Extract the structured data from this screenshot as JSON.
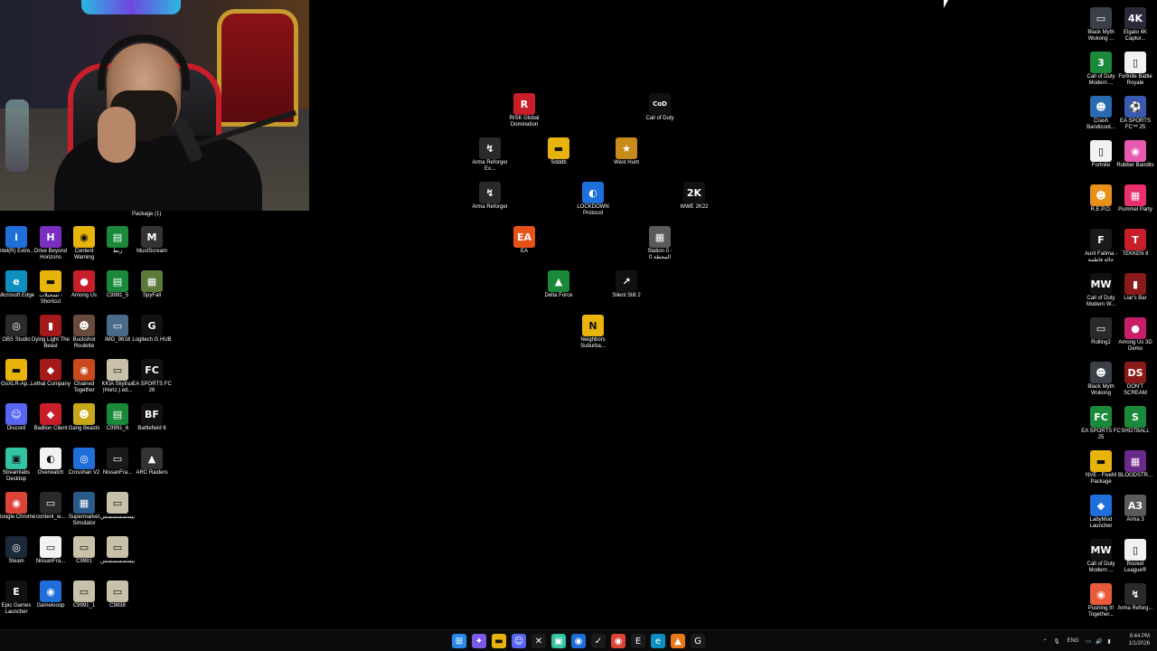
{
  "webcam": {
    "package_label": "Package (1)"
  },
  "icon_colors": {
    "default": "#3a3f48",
    "blue": "#1e6fd9",
    "green": "#1a8a3a",
    "red": "#c81e2a",
    "yellow": "#e8b40c",
    "purple": "#7b2fc2",
    "white": "#f2f2f2",
    "dark": "#1a1a1a"
  },
  "left_icons": [
    {
      "label": "Intel(R) Extre...",
      "icon": "intel-icon",
      "glyph": "i",
      "color": "#1e6fd9"
    },
    {
      "label": "Drive Beyond Horizons",
      "icon": "drive-beyond-horizons-icon",
      "glyph": "H",
      "color": "#7b2fc2"
    },
    {
      "label": "Content Warning",
      "icon": "content-warning-icon",
      "glyph": "◉",
      "color": "#e8b40c"
    },
    {
      "label": "زنط",
      "icon": "steam-shortcut-icon",
      "glyph": "▤",
      "color": "#1a8a3a"
    },
    {
      "label": "MustScream",
      "icon": "mustscream-icon",
      "glyph": "M",
      "color": "#333333"
    },
    {
      "label": "Microsoft Edge",
      "icon": "edge-icon",
      "glyph": "e",
      "color": "#0f8fbf"
    },
    {
      "label": "تسجيلات - Shortcut",
      "icon": "folder-shortcut-icon",
      "glyph": "▬",
      "color": "#e8b40c"
    },
    {
      "label": "Among Us",
      "icon": "among-us-icon",
      "glyph": "●",
      "color": "#c81e2a"
    },
    {
      "label": "C9991_5",
      "icon": "c9991-5-icon",
      "glyph": "▤",
      "color": "#1a8a3a"
    },
    {
      "label": "SpyFall",
      "icon": "spyfall-icon",
      "glyph": "▦",
      "color": "#5a7a3a"
    },
    {
      "label": "OBS Studio",
      "icon": "obs-icon",
      "glyph": "◎",
      "color": "#2a2a2a"
    },
    {
      "label": "Dying Light The Beast",
      "icon": "dying-light-icon",
      "glyph": "▮",
      "color": "#a31a1a"
    },
    {
      "label": "Buckshot Roulette",
      "icon": "buckshot-roulette-icon",
      "glyph": "☻",
      "color": "#6a4a3a"
    },
    {
      "label": "IMG_9618",
      "icon": "image-file-icon",
      "glyph": "▭",
      "color": "#4a6a8a"
    },
    {
      "label": "Logitech G HUB",
      "icon": "logitech-icon",
      "glyph": "G",
      "color": "#111111"
    },
    {
      "label": "GoXLR-Ap...",
      "icon": "goxlr-folder-icon",
      "glyph": "▬",
      "color": "#e8b40c"
    },
    {
      "label": "Lethal Company",
      "icon": "lethal-company-icon",
      "glyph": "◆",
      "color": "#a31a1a"
    },
    {
      "label": "Chained Together",
      "icon": "chained-together-icon",
      "glyph": "◉",
      "color": "#c84a1a"
    },
    {
      "label": "KKIA Skytrax (Horiz.) ed...",
      "icon": "kkia-image-icon",
      "glyph": "▭",
      "color": "#c8c0a8"
    },
    {
      "label": "EA SPORTS FC 26",
      "icon": "ea-fc26-icon",
      "glyph": "FC",
      "color": "#111111"
    },
    {
      "label": "Discord",
      "icon": "discord-icon",
      "glyph": "☺",
      "color": "#5865f2"
    },
    {
      "label": "Badlion Client",
      "icon": "badlion-icon",
      "glyph": "◆",
      "color": "#c81e2a"
    },
    {
      "label": "Gang Beasts",
      "icon": "gang-beasts-icon",
      "glyph": "☻",
      "color": "#c8a81a"
    },
    {
      "label": "C9991_6",
      "icon": "c9991-6-icon",
      "glyph": "▤",
      "color": "#1a8a3a"
    },
    {
      "label": "Battlefield 6",
      "icon": "battlefield-6-icon",
      "glyph": "BF",
      "color": "#111111"
    },
    {
      "label": "Streamlabs Desktop",
      "icon": "streamlabs-icon",
      "glyph": "▣",
      "color": "#31c3a2"
    },
    {
      "label": "Overwatch",
      "icon": "overwatch-icon",
      "glyph": "◐",
      "color": "#f2f2f2"
    },
    {
      "label": "Crosshair V2",
      "icon": "crosshair-icon",
      "glyph": "◎",
      "color": "#1e6fd9"
    },
    {
      "label": "NissanFra...",
      "icon": "nissan-image-icon",
      "glyph": "▭",
      "color": "#1a1a1a"
    },
    {
      "label": "ARC Raiders",
      "icon": "arc-raiders-icon",
      "glyph": "▲",
      "color": "#333333"
    },
    {
      "label": "Google Chrome",
      "icon": "chrome-icon",
      "glyph": "◉",
      "color": "#db4437"
    },
    {
      "label": "content_w...",
      "icon": "content-file-icon",
      "glyph": "▭",
      "color": "#2a2a2a"
    },
    {
      "label": "Supermarket Simulator",
      "icon": "supermarket-simulator-icon",
      "glyph": "▦",
      "color": "#2a5a8a"
    },
    {
      "label": "ييسسسسسس",
      "icon": "video-file-icon",
      "glyph": "▭",
      "color": "#c8c0a8"
    },
    {
      "label": "",
      "icon": "",
      "glyph": "",
      "color": ""
    },
    {
      "label": "Steam",
      "icon": "steam-icon",
      "glyph": "◎",
      "color": "#1b2838"
    },
    {
      "label": "NissanFra...",
      "icon": "nissan-image-2-icon",
      "glyph": "▭",
      "color": "#f2f2f2"
    },
    {
      "label": "C9991",
      "icon": "c9991-icon",
      "glyph": "▭",
      "color": "#c8c0a8"
    },
    {
      "label": "ييسسسسسس",
      "icon": "video-file-2-icon",
      "glyph": "▭",
      "color": "#c8c0a8"
    },
    {
      "label": "",
      "icon": "",
      "glyph": "",
      "color": ""
    },
    {
      "label": "Epic Games Launcher",
      "icon": "epic-games-icon",
      "glyph": "E",
      "color": "#111111"
    },
    {
      "label": "Gamelooop",
      "icon": "gameloop-icon",
      "glyph": "◉",
      "color": "#1e6fd9"
    },
    {
      "label": "C9991_1",
      "icon": "c9991-1-icon",
      "glyph": "▭",
      "color": "#c8c0a8"
    },
    {
      "label": "C9838",
      "icon": "c9838-icon",
      "glyph": "▭",
      "color": "#c8c0a8"
    }
  ],
  "center_icons": [
    {
      "label": "RISK Global Domination",
      "icon": "risk-icon",
      "glyph": "R",
      "color": "#c81e2a",
      "pos": "a"
    },
    {
      "label": "Call of Duty",
      "icon": "call-of-duty-icon",
      "glyph": "CoD",
      "color": "#111111",
      "pos": "b"
    },
    {
      "label": "Arma Reforger Ex...",
      "icon": "arma-reforger-ex-icon",
      "glyph": "↯",
      "color": "#2a2a2a",
      "pos": "c"
    },
    {
      "label": "Sdddb",
      "icon": "sdddb-folder-icon",
      "glyph": "▬",
      "color": "#e8b40c",
      "pos": "d"
    },
    {
      "label": "West Hunt",
      "icon": "west-hunt-icon",
      "glyph": "★",
      "color": "#c88a1a",
      "pos": "e"
    },
    {
      "label": "Arma Reforger",
      "icon": "arma-reforger-icon",
      "glyph": "↯",
      "color": "#2a2a2a",
      "pos": "f"
    },
    {
      "label": "LOCKDOWN Protocol",
      "icon": "lockdown-protocol-icon",
      "glyph": "◐",
      "color": "#1e6fd9",
      "pos": "g"
    },
    {
      "label": "WWE 2K22",
      "icon": "wwe-2k22-icon",
      "glyph": "2K",
      "color": "#111111",
      "pos": "h"
    },
    {
      "label": "EA",
      "icon": "ea-icon",
      "glyph": "EA",
      "color": "#e8501a",
      "pos": "i"
    },
    {
      "label": "Station 0 - المحطة 0",
      "icon": "station-0-icon",
      "glyph": "▦",
      "color": "#5a5a5a",
      "pos": "j"
    },
    {
      "label": "Delta Force",
      "icon": "delta-force-icon",
      "glyph": "▲",
      "color": "#1a8a3a",
      "pos": "k"
    },
    {
      "label": "Silent Still 2",
      "icon": "silent-still-2-icon",
      "glyph": "↗",
      "color": "#111111",
      "pos": "l"
    },
    {
      "label": "Neighbors Suburba...",
      "icon": "neighbors-suburbia-icon",
      "glyph": "N",
      "color": "#e8b40c",
      "pos": "m"
    }
  ],
  "right_icons": [
    {
      "label": "Black Myth Wukong ...",
      "icon": "black-myth-wukong-icon",
      "glyph": "▭",
      "color": "#3a3f48"
    },
    {
      "label": "Elgato 4K Captur...",
      "icon": "elgato-4k-icon",
      "glyph": "4K",
      "color": "#2a2a3a"
    },
    {
      "label": "Call of Duty Modern ...",
      "icon": "cod-modern-icon",
      "glyph": "3",
      "color": "#1a8a3a"
    },
    {
      "label": "Fortnite Battle Royale",
      "icon": "fortnite-file-icon",
      "glyph": "▯",
      "color": "#f2f2f2"
    },
    {
      "label": "Crash Bandicoot...",
      "icon": "crash-bandicoot-icon",
      "glyph": "☻",
      "color": "#2a6ab0"
    },
    {
      "label": "EA SPORTS FC™ 25",
      "icon": "ea-fc25-icon",
      "glyph": "⚽",
      "color": "#3a5ab0"
    },
    {
      "label": "Fortnite",
      "icon": "fortnite-icon",
      "glyph": "▯",
      "color": "#f2f2f2"
    },
    {
      "label": "Rubber Bandits",
      "icon": "rubber-bandits-icon",
      "glyph": "◉",
      "color": "#e85ab0"
    },
    {
      "label": "R.E.P.O.",
      "icon": "repo-icon",
      "glyph": "☻",
      "color": "#e8901a"
    },
    {
      "label": "Pummel Party",
      "icon": "pummel-party-icon",
      "glyph": "▦",
      "color": "#e8306a"
    },
    {
      "label": "Aunt Fatima - خالة فاطمة",
      "icon": "aunt-fatima-icon",
      "glyph": "F",
      "color": "#1a1a1a"
    },
    {
      "label": "TEKKEN 8",
      "icon": "tekken-8-icon",
      "glyph": "T",
      "color": "#c81e2a"
    },
    {
      "label": "Call of Duty Modern W...",
      "icon": "cod-mw-icon",
      "glyph": "MW",
      "color": "#111111"
    },
    {
      "label": "Liar's Bar",
      "icon": "liars-bar-icon",
      "glyph": "▮",
      "color": "#8a1a1a"
    },
    {
      "label": "Rolling2",
      "icon": "rolling2-icon",
      "glyph": "▭",
      "color": "#2a2a2a"
    },
    {
      "label": "Among Us 3D Demo",
      "icon": "among-us-3d-icon",
      "glyph": "●",
      "color": "#c81e6a"
    },
    {
      "label": "Black Myth Wukong",
      "icon": "black-myth-wukong-2-icon",
      "glyph": "☻",
      "color": "#3a3f48"
    },
    {
      "label": "DON'T SCREAM",
      "icon": "dont-scream-icon",
      "glyph": "DS",
      "color": "#8a1a1a"
    },
    {
      "label": "EA SPORTS FC 25",
      "icon": "ea-fc25-2-icon",
      "glyph": "FC",
      "color": "#1a8a3a"
    },
    {
      "label": "SHOTBALL",
      "icon": "shotball-icon",
      "glyph": "S",
      "color": "#1a8a3a"
    },
    {
      "label": "NVE - FiveM Package",
      "icon": "nve-folder-icon",
      "glyph": "▬",
      "color": "#e8b40c"
    },
    {
      "label": "BLOODSTR...",
      "icon": "bloodstrike-icon",
      "glyph": "▦",
      "color": "#6a2a8a"
    },
    {
      "label": "LabyMod Launcher",
      "icon": "labymod-icon",
      "glyph": "◆",
      "color": "#1e6fd9"
    },
    {
      "label": "Arma 3",
      "icon": "arma-3-icon",
      "glyph": "A3",
      "color": "#5a5a5a"
    },
    {
      "label": "Call of Duty Modern ...",
      "icon": "cod-modern-2-icon",
      "glyph": "MW",
      "color": "#111111"
    },
    {
      "label": "Rocket League®",
      "icon": "rocket-league-icon",
      "glyph": "▯",
      "color": "#f2f2f2"
    },
    {
      "label": "Pushing It! Together...",
      "icon": "pushing-it-icon",
      "glyph": "◉",
      "color": "#e85a3a"
    },
    {
      "label": "Arma Reforg...",
      "icon": "arma-reforger-2-icon",
      "glyph": "↯",
      "color": "#2a2a2a"
    }
  ],
  "taskbar": {
    "apps": [
      {
        "name": "start-button",
        "glyph": "⊞",
        "color": "#2a8ae8"
      },
      {
        "name": "copilot-icon",
        "glyph": "✦",
        "color": "#7a5ae8"
      },
      {
        "name": "file-explorer-icon",
        "glyph": "▬",
        "color": "#e8b40c"
      },
      {
        "name": "discord-taskbar-icon",
        "glyph": "☺",
        "color": "#5865f2"
      },
      {
        "name": "xbox-icon",
        "glyph": "✕",
        "color": "#1a1a1a"
      },
      {
        "name": "streamlabs-taskbar-icon",
        "glyph": "▣",
        "color": "#31c3a2"
      },
      {
        "name": "browser-taskbar-icon",
        "glyph": "◉",
        "color": "#1e6fd9"
      },
      {
        "name": "capcut-icon",
        "glyph": "✓",
        "color": "#1a1a1a"
      },
      {
        "name": "chrome-taskbar-icon",
        "glyph": "◉",
        "color": "#db4437"
      },
      {
        "name": "epic-taskbar-icon",
        "glyph": "E",
        "color": "#1a1a1a"
      },
      {
        "name": "edge-taskbar-icon",
        "glyph": "e",
        "color": "#0f8fbf"
      },
      {
        "name": "obs-taskbar-icon",
        "glyph": "▲",
        "color": "#e8781a"
      },
      {
        "name": "logitech-taskbar-icon",
        "glyph": "G",
        "color": "#1a1a1a"
      }
    ],
    "tray": {
      "chevron": "⌃",
      "mic": "🎙",
      "lang": "ENG",
      "network": "▭",
      "volume": "🔊",
      "battery": "▮"
    },
    "time": "9:44 PM",
    "date": "1/1/2026"
  }
}
